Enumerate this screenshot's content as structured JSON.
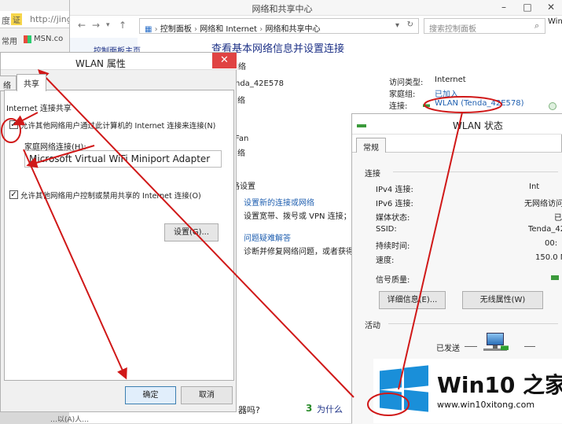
{
  "browser": {
    "address_fragment": "http://jingy",
    "lead_fragment": "度",
    "badge": "证",
    "bookmarks_label": "常用",
    "msn_label": "MSN.co"
  },
  "nsc": {
    "title": "网络和共享中心",
    "breadcrumb": [
      "控制面板",
      "网络和 Internet",
      "网络和共享中心"
    ],
    "search_placeholder": "搜索控制面板",
    "sidebar_fragment": "控制面板主页",
    "heading": "查看基本网络信息并设置连接",
    "section_label": "网络",
    "net1_name": "nda_42E578",
    "net1_type": "络",
    "net2_name": "Fan",
    "net2_type": "络",
    "access_type_label": "访问类型:",
    "access_type_value": "Internet",
    "homegroup_label": "家庭组:",
    "homegroup_value": "已加入",
    "connection_label": "连接:",
    "connection_value": "WLAN (Tenda_42E578)",
    "settings_fragment": "路设置",
    "setup_link": "设置新的连接或网络",
    "setup_desc": "设置宽带、拨号或 VPN 连接；或",
    "troubleshoot_link": "问题疑难解答",
    "troubleshoot_desc": "诊断并修复网络问题，或者获得疑",
    "right_edge_frag": "Win",
    "bottom_question_frag": "器吗?",
    "bottom_num": "3",
    "bottom_why": "为什么"
  },
  "props": {
    "title": "WLAN 属性",
    "tab_network_frag": "络",
    "tab_sharing": "共享",
    "group_label": "Internet 连接共享",
    "allow_share_label": "允许其他网络用户通过此计算机的 Internet 连接来连接(N)",
    "home_net_label": "家庭网络连接(H):",
    "adapter_value": "Microsoft Virtual WiFi Miniport Adapter",
    "allow_control_label": "允许其他网络用户控制或禁用共享的 Internet 连接(O)",
    "settings_button": "设置(G)...",
    "ok_button": "确定",
    "cancel_button": "取消",
    "bg_text_frag": "…以(A)人…"
  },
  "status": {
    "title": "WLAN 状态",
    "tab_general": "常规",
    "connection_section": "连接",
    "rows": [
      {
        "label": "IPv4 连接:",
        "value": "Int"
      },
      {
        "label": "IPv6 连接:",
        "value": "无网络访问"
      },
      {
        "label": "媒体状态:",
        "value": "已"
      },
      {
        "label": "SSID:",
        "value": "Tenda_42"
      },
      {
        "label": "持续时间:",
        "value": "00:"
      },
      {
        "label": "速度:",
        "value": "150.0 M"
      }
    ],
    "signal_label": "信号质量:",
    "details_button": "详细信息(E)...",
    "wireless_props_button": "无线属性(W)",
    "activity_section": "活动",
    "sent_label": "已发送"
  },
  "watermark": {
    "brand": "Win10 之家",
    "url": "www.win10xitong.com"
  },
  "colors": {
    "annotation": "#d01818",
    "link": "#1f5fb0",
    "heading": "#1e3287",
    "close": "#e04343",
    "logo_blue": "#1a8fd9"
  }
}
